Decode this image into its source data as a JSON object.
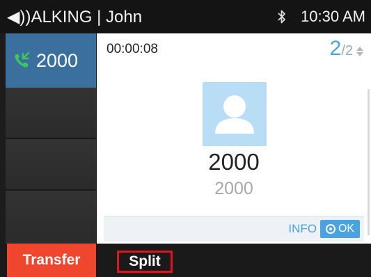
{
  "status_bar": {
    "title": "◀))ALKING | John",
    "time": "10:30 AM",
    "bluetooth_icon": "bluetooth-icon",
    "speaker_icon": "speaker-icon"
  },
  "lines": {
    "active_line": {
      "icon": "phone-call-icon",
      "label": "2000"
    },
    "empty_slots": 3
  },
  "call": {
    "timer": "00:00:08",
    "current_index": "2",
    "total": "/2",
    "contact_name": "2000",
    "contact_number": "2000",
    "info_label": "INFO",
    "ok_label": "OK"
  },
  "softkeys": {
    "transfer": "Transfer",
    "split": "Split"
  },
  "colors": {
    "accent_blue": "#4aa3df",
    "active_line_bg": "#3a6f9e",
    "transfer_red": "#f0462e",
    "highlight_border": "#e3121e"
  }
}
